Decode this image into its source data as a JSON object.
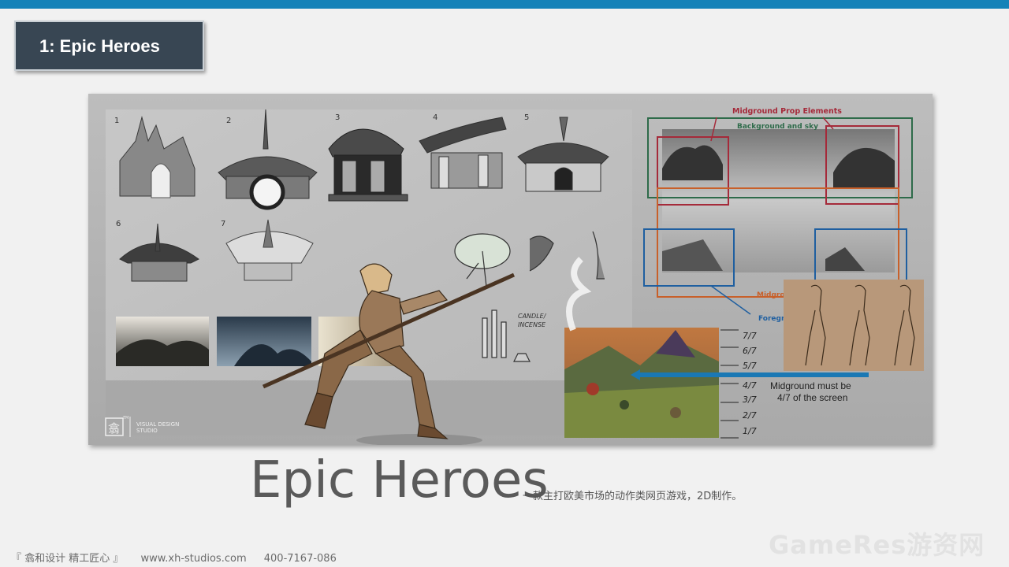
{
  "slide": {
    "title_tab": "1: Epic Heroes",
    "heading": "Epic Heroes",
    "description": "一款主打欧美市场的动作类网页游戏，2D制作。"
  },
  "artwork": {
    "sketch_numbers": [
      "1",
      "2",
      "3",
      "4",
      "5",
      "6",
      "7"
    ],
    "annotations": {
      "midground_prop": "Midground Prop Elements",
      "background_sky": "Background and sky",
      "midground": "Midgro",
      "foreground": "Foregr",
      "midground_note_1": "Midground must be",
      "midground_note_2": "4/7 of the screen",
      "candle": "CANDLE/",
      "incense": "INCENSE"
    },
    "scale_labels": [
      "7/7",
      "6/7",
      "5/7",
      "4/7",
      "3/7",
      "2/7",
      "1/7"
    ],
    "studio_label_1": "VISUAL DESIGN",
    "studio_label_2": "STUDIO",
    "studio_logo_glyph": "翕",
    "studio_tm": "TM"
  },
  "footer": {
    "slogan": "『 翕和设计  精工匠心 』",
    "website": "www.xh-studios.com",
    "phone": "400-7167-086"
  },
  "watermark": "GameRes游资网",
  "colors": {
    "top_bar": "#1482b8",
    "title_bg": "#384653",
    "prop_red": "#a52a3a",
    "sky_green": "#2e6b4a",
    "mid_orange": "#c8602a",
    "fore_blue": "#1f5fa0"
  }
}
